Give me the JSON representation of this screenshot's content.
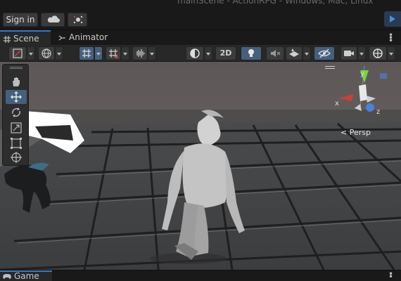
{
  "window": {
    "title": "mainScene - ActionRPG - Windows, Mac, Linux"
  },
  "toolbar": {
    "signin_label": "Sign in",
    "cloud_icon": "cloud-icon",
    "collab_icon": "collab-icon",
    "play_icon": "play-icon"
  },
  "tabs": [
    {
      "label": "Scene",
      "icon": "grid-icon",
      "active": true
    },
    {
      "label": "Animator",
      "icon": "animator-icon",
      "active": false
    }
  ],
  "scene_toolbar": {
    "mode_2d_label": "2D"
  },
  "gizmo": {
    "y_label": "y",
    "x_label": "x",
    "z_label": "z",
    "projection_label": "< Persp"
  },
  "bottom_tabs": [
    {
      "label": "Game",
      "icon": "gamepad-icon"
    }
  ],
  "colors": {
    "accent": "#3a79bb",
    "toggle_on": "#46607c",
    "panel": "#282828",
    "background": "#191919"
  }
}
